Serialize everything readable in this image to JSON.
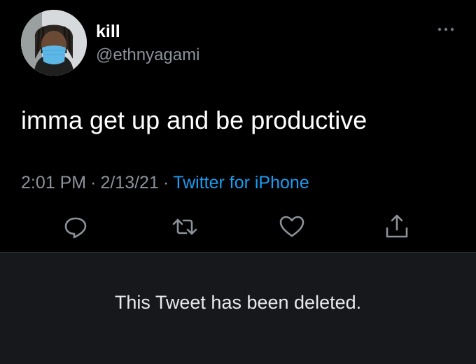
{
  "tweet": {
    "display_name": "kill",
    "handle": "@ethnyagami",
    "text": "imma get up and be productive",
    "time": "2:01 PM",
    "date": "2/13/21",
    "separator": "·",
    "source": "Twitter for iPhone",
    "more_icon": "more-dots-icon",
    "actions": [
      {
        "icon": "reply-icon"
      },
      {
        "icon": "retweet-icon"
      },
      {
        "icon": "like-icon"
      },
      {
        "icon": "share-icon"
      }
    ]
  },
  "deleted_notice": {
    "text": "This Tweet has been deleted."
  },
  "colors": {
    "background": "#000000",
    "text_primary": "#ffffff",
    "text_secondary": "#8b9299",
    "link": "#1d9bf0",
    "deleted_panel": "#16181c"
  }
}
